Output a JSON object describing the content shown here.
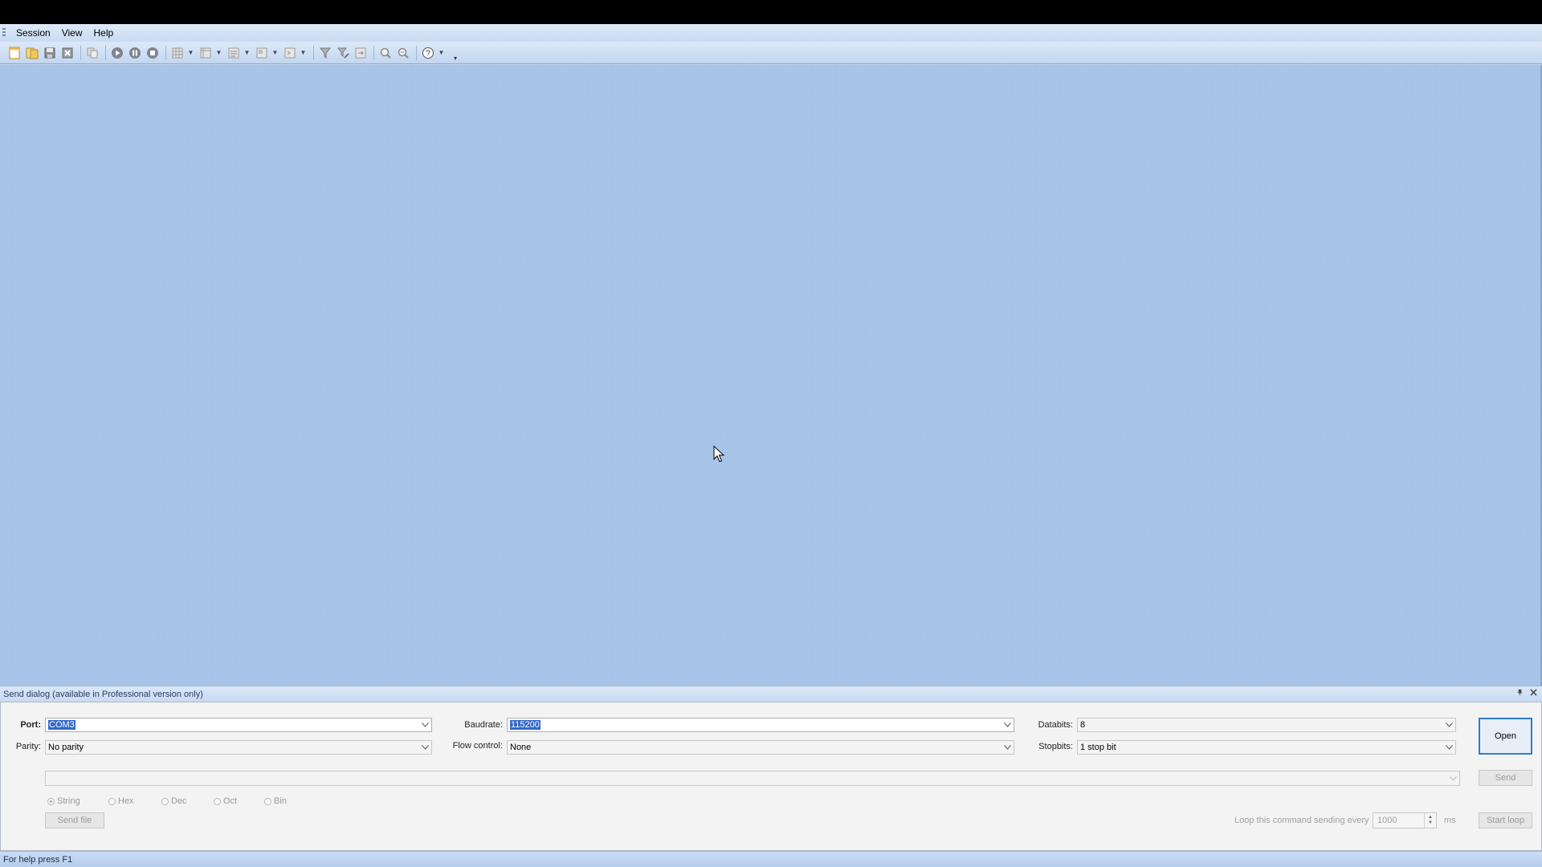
{
  "menu": {
    "items": [
      "Session",
      "View",
      "Help"
    ]
  },
  "toolbar": {
    "buttons": [
      "new-session-icon",
      "open-session-icon",
      "save-icon",
      "close-icon",
      "copy-icon",
      "play-icon",
      "pause-icon",
      "stop-icon",
      "grid-view-icon",
      "table-view-icon",
      "line-view-icon",
      "dump-view-icon",
      "terminal-view-icon",
      "filter-icon",
      "filter-edit-icon",
      "export-icon",
      "find-icon",
      "find-next-icon",
      "help-icon"
    ]
  },
  "send_dialog": {
    "title": "Send dialog (available in Professional version only)",
    "port_label": "Port:",
    "port_value": "COM3",
    "parity_label": "Parity:",
    "parity_value": "No parity",
    "baudrate_label": "Baudrate:",
    "baudrate_value": "115200",
    "flow_label": "Flow control:",
    "flow_value": "None",
    "databits_label": "Databits:",
    "databits_value": "8",
    "stopbits_label": "Stopbits:",
    "stopbits_value": "1 stop bit",
    "open_label": "Open",
    "send_label": "Send",
    "send_file_label": "Send file",
    "formats": [
      "String",
      "Hex",
      "Dec",
      "Oct",
      "Bin"
    ],
    "selected_format": "String",
    "loop_label": "Loop this command sending every",
    "loop_value": "1000",
    "loop_unit": "ms",
    "start_loop_label": "Start loop"
  },
  "status": {
    "text": "For help press F1"
  }
}
